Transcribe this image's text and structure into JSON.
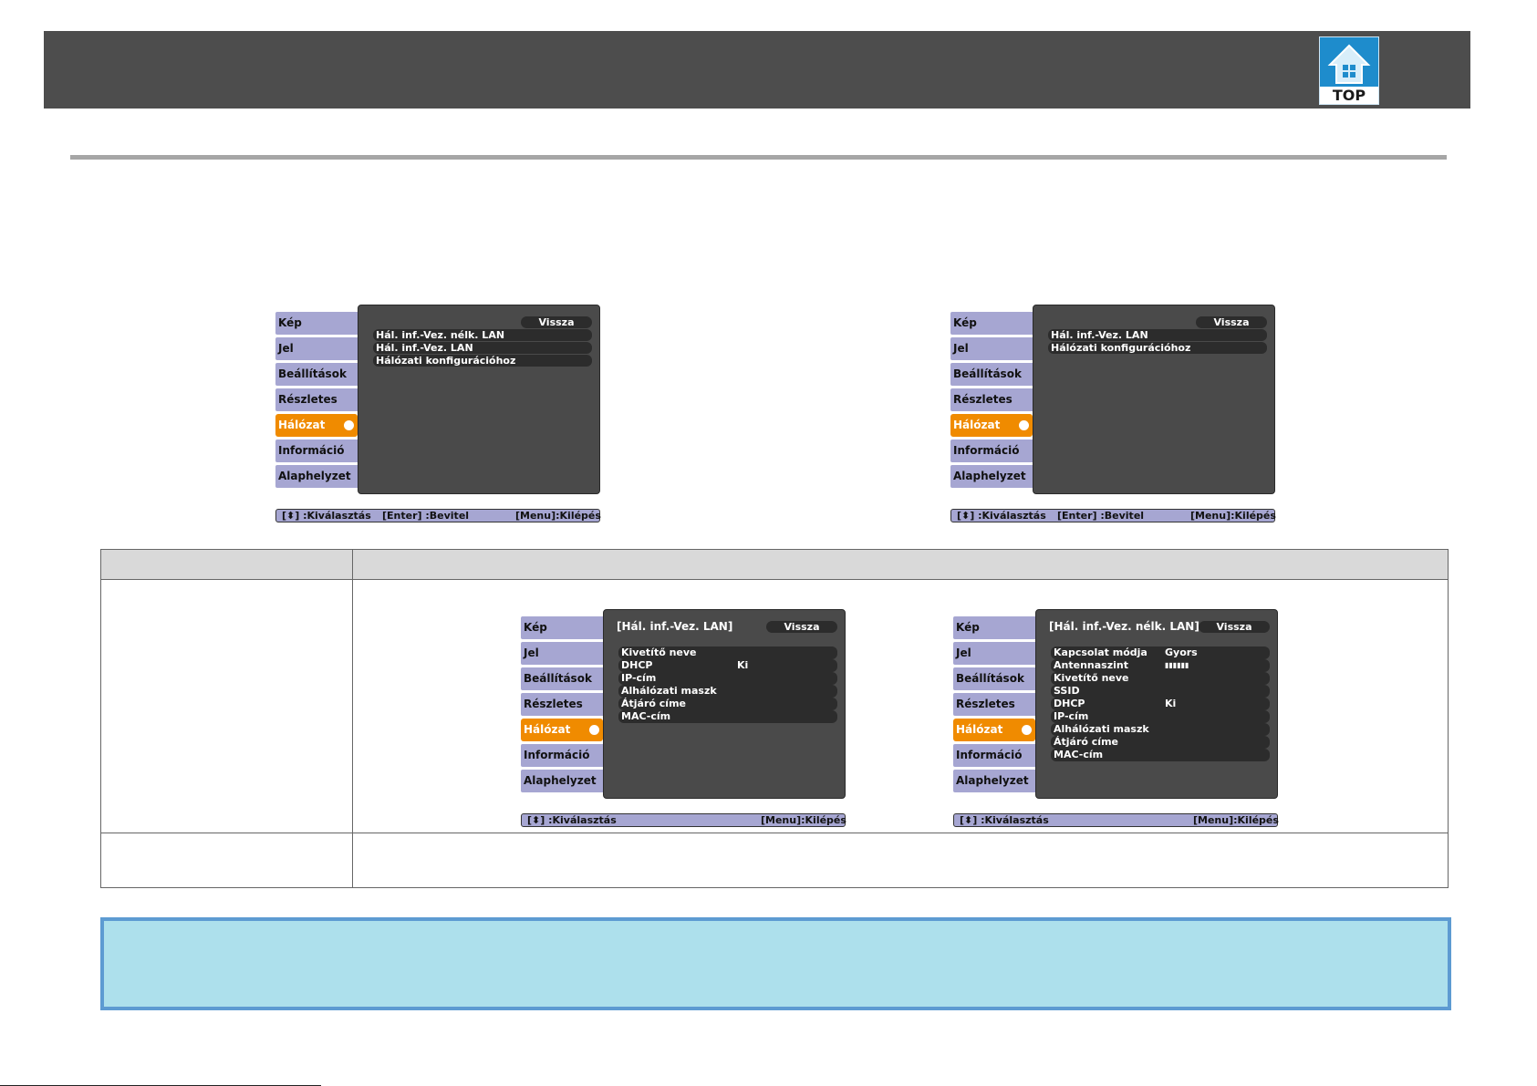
{
  "header": {
    "logo_text": "TOP"
  },
  "menus": [
    {
      "nav": [
        "Kép",
        "Jel",
        "Beállítások",
        "Részletes",
        "Hálózat",
        "Információ",
        "Alaphelyzet"
      ],
      "selected": 4,
      "panel_title": "",
      "back": "Vissza",
      "items": [
        "Hál. inf.-Vez. nélk. LAN",
        "Hál. inf.-Vez. LAN",
        "Hálózati konfigurációhoz"
      ],
      "hint": {
        "select": "[⬍] :Kiválasztás",
        "enter": "[Enter] :Bevitel",
        "exit": "[Menu]:Kilépés"
      }
    },
    {
      "nav": [
        "Kép",
        "Jel",
        "Beállítások",
        "Részletes",
        "Hálózat",
        "Információ",
        "Alaphelyzet"
      ],
      "selected": 4,
      "panel_title": "",
      "back": "Vissza",
      "items": [
        "Hál. inf.-Vez. LAN",
        "Hálózati konfigurációhoz"
      ],
      "hint": {
        "select": "[⬍] :Kiválasztás",
        "enter": "[Enter] :Bevitel",
        "exit": "[Menu]:Kilépés"
      }
    },
    {
      "nav": [
        "Kép",
        "Jel",
        "Beállítások",
        "Részletes",
        "Hálózat",
        "Információ",
        "Alaphelyzet"
      ],
      "selected": 4,
      "panel_title": "[Hál. inf.-Vez. LAN]",
      "back": "Vissza",
      "rows": [
        {
          "label": "Kivetítő neve",
          "value": ""
        },
        {
          "label": "DHCP",
          "value": "Ki"
        },
        {
          "label": "IP-cím",
          "value": ""
        },
        {
          "label": "Alhálózati maszk",
          "value": ""
        },
        {
          "label": "Átjáró címe",
          "value": ""
        },
        {
          "label": "MAC-cím",
          "value": ""
        }
      ],
      "hint": {
        "select": "[⬍] :Kiválasztás",
        "enter": "",
        "exit": "[Menu]:Kilépés"
      }
    },
    {
      "nav": [
        "Kép",
        "Jel",
        "Beállítások",
        "Részletes",
        "Hálózat",
        "Információ",
        "Alaphelyzet"
      ],
      "selected": 4,
      "panel_title": "[Hál. inf.-Vez. nélk. LAN]",
      "back": "Vissza",
      "rows": [
        {
          "label": "Kapcsolat módja",
          "value": "Gyors"
        },
        {
          "label": "Antennaszint",
          "value": "▮▮▮▮▮▮"
        },
        {
          "label": "Kivetítő neve",
          "value": ""
        },
        {
          "label": "SSID",
          "value": ""
        },
        {
          "label": "DHCP",
          "value": "Ki"
        },
        {
          "label": "IP-cím",
          "value": ""
        },
        {
          "label": "Alhálózati maszk",
          "value": ""
        },
        {
          "label": "Átjáró címe",
          "value": ""
        },
        {
          "label": "MAC-cím",
          "value": ""
        }
      ],
      "hint": {
        "select": "[⬍] :Kiválasztás",
        "enter": "",
        "exit": "[Menu]:Kilépés"
      }
    }
  ]
}
